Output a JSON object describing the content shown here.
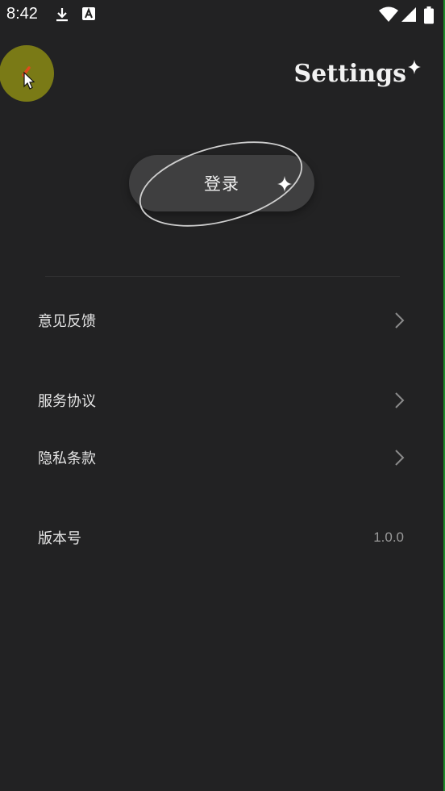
{
  "status_bar": {
    "time": "8:42",
    "icons": [
      "download-icon",
      "text-a-icon",
      "wifi-icon",
      "signal-icon",
      "battery-icon"
    ]
  },
  "header": {
    "title": "Settings",
    "back_icon": "chevron-left-icon"
  },
  "login": {
    "label": "登录"
  },
  "menu": {
    "items": [
      {
        "label": "意见反馈",
        "icon": "chevron-right-icon"
      },
      {
        "label": "服务协议",
        "icon": "chevron-right-icon"
      },
      {
        "label": "隐私条款",
        "icon": "chevron-right-icon"
      }
    ],
    "version": {
      "label": "版本号",
      "value": "1.0.0"
    }
  },
  "colors": {
    "background": "#222223",
    "button": "#3f3f40",
    "back_highlight": "#7a7a16",
    "text": "#e4e4e4",
    "muted": "#9a9a9a"
  }
}
